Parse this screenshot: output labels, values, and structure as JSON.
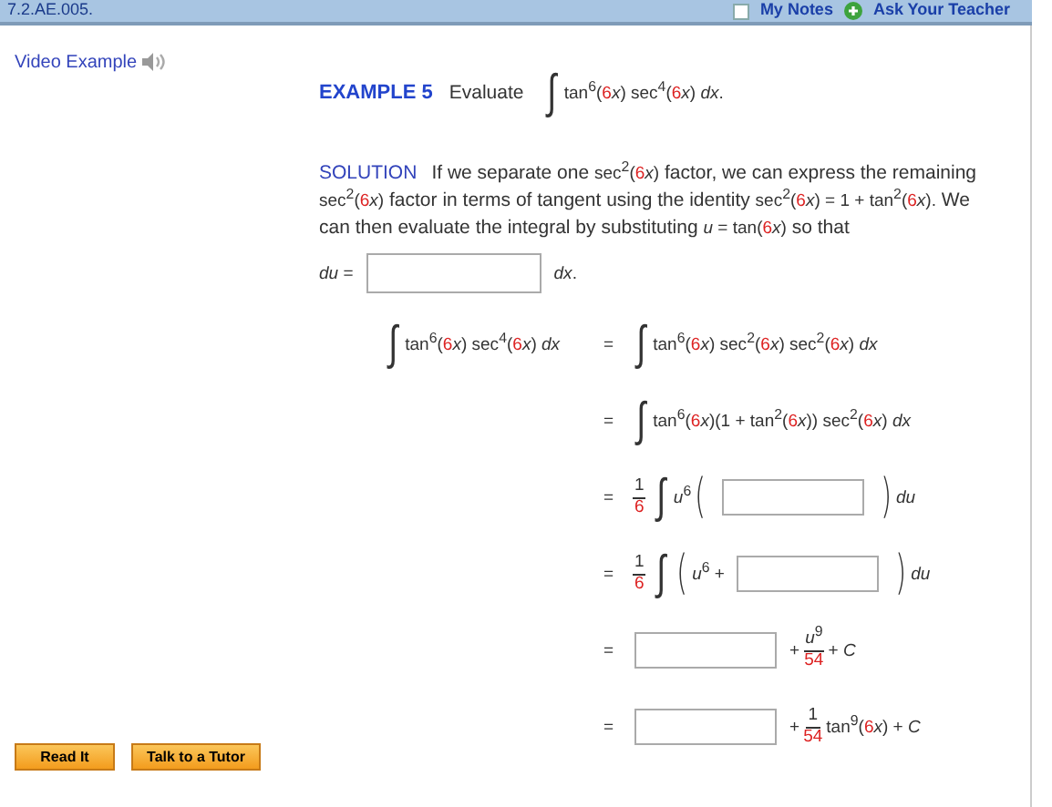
{
  "header": {
    "assignment": "7.2.AE.005.",
    "notes": {
      "label": "My Notes",
      "checked": false
    },
    "ask": "Ask Your Teacher"
  },
  "video_example": "Video Example",
  "example": {
    "label": "EXAMPLE 5",
    "prompt": "Evaluate",
    "expression": [
      {
        "kind": "integral",
        "t": "∫"
      },
      {
        "kind": "math",
        "t": "tan$^{6}$("
      },
      {
        "kind": "accent",
        "t": "6"
      },
      {
        "kind": "math",
        "t": "*x*) sec$^{4}$("
      },
      {
        "kind": "accent",
        "t": "6"
      },
      {
        "kind": "math",
        "t": "*x*) *dx*."
      }
    ]
  },
  "solution": {
    "label": "SOLUTION",
    "paragraph": [
      {
        "kind": "text",
        "t": "If we separate one "
      },
      {
        "kind": "math",
        "t": "sec$^{2}$("
      },
      {
        "kind": "accent",
        "t": "6"
      },
      {
        "kind": "math",
        "t": "*x*)"
      },
      {
        "kind": "text",
        "t": " factor, we can express the remaining "
      },
      {
        "kind": "math",
        "t": "sec$^{2}$("
      },
      {
        "kind": "accent",
        "t": "6"
      },
      {
        "kind": "math",
        "t": "*x*)"
      },
      {
        "kind": "text",
        "t": " factor in terms of tangent using the identity "
      },
      {
        "kind": "math",
        "t": "sec$^{2}$("
      },
      {
        "kind": "accent",
        "t": "6"
      },
      {
        "kind": "math",
        "t": "*x*) = 1 + tan$^{2}$("
      },
      {
        "kind": "accent",
        "t": "6"
      },
      {
        "kind": "math",
        "t": "*x*)."
      },
      {
        "kind": "text",
        "t": " We can then evaluate the integral by substituting "
      },
      {
        "kind": "math",
        "t": "*u* = tan("
      },
      {
        "kind": "accent",
        "t": "6"
      },
      {
        "kind": "math",
        "t": "*x*)"
      },
      {
        "kind": "text",
        "t": " so that"
      }
    ]
  },
  "du_row": [
    {
      "kind": "math",
      "t": "*du* ="
    },
    {
      "kind": "blank"
    },
    {
      "kind": "math",
      "t": "*dx*."
    }
  ],
  "steps": [
    {
      "lhs": [
        {
          "kind": "integral",
          "t": "∫"
        },
        {
          "kind": "math",
          "t": "tan$^{6}$("
        },
        {
          "kind": "accent",
          "t": "6"
        },
        {
          "kind": "math",
          "t": "*x*) sec$^{4}$("
        },
        {
          "kind": "accent",
          "t": "6"
        },
        {
          "kind": "math",
          "t": "*x*) *dx*"
        }
      ],
      "relation": "=",
      "rhs": [
        {
          "kind": "integral",
          "t": "∫"
        },
        {
          "kind": "math",
          "t": "tan$^{6}$("
        },
        {
          "kind": "accent",
          "t": "6"
        },
        {
          "kind": "math",
          "t": "*x*) sec$^{2}$("
        },
        {
          "kind": "accent",
          "t": "6"
        },
        {
          "kind": "math",
          "t": "*x*) sec$^{2}$("
        },
        {
          "kind": "accent",
          "t": "6"
        },
        {
          "kind": "math",
          "t": "*x*) *dx*"
        }
      ]
    },
    {
      "relation": "=",
      "rhs": [
        {
          "kind": "integral",
          "t": "∫"
        },
        {
          "kind": "math",
          "t": "tan$^{6}$("
        },
        {
          "kind": "accent",
          "t": "6"
        },
        {
          "kind": "math",
          "t": "*x*)(1 + tan$^{2}$("
        },
        {
          "kind": "accent",
          "t": "6"
        },
        {
          "kind": "math",
          "t": "*x*)) sec$^{2}$("
        },
        {
          "kind": "accent",
          "t": "6"
        },
        {
          "kind": "math",
          "t": "*x*) *dx*"
        }
      ]
    },
    {
      "relation": "=",
      "rhs": [
        {
          "kind": "frac",
          "num": [
            {
              "kind": "math",
              "t": "1"
            }
          ],
          "den": [
            {
              "kind": "accent",
              "t": "6"
            }
          ]
        },
        {
          "kind": "integral",
          "t": "∫"
        },
        {
          "kind": "math",
          "t": "*u*$^{6}$"
        },
        {
          "kind": "paren",
          "t": "("
        },
        {
          "kind": "blank"
        },
        {
          "kind": "paren",
          "t": ")"
        },
        {
          "kind": "math",
          "t": "*du*"
        }
      ]
    },
    {
      "relation": "=",
      "rhs": [
        {
          "kind": "frac",
          "num": [
            {
              "kind": "math",
              "t": "1"
            }
          ],
          "den": [
            {
              "kind": "accent",
              "t": "6"
            }
          ]
        },
        {
          "kind": "integral",
          "t": "∫"
        },
        {
          "kind": "paren",
          "t": "("
        },
        {
          "kind": "math",
          "t": "*u*$^{6}$ +"
        },
        {
          "kind": "blank"
        },
        {
          "kind": "paren",
          "t": ")"
        },
        {
          "kind": "math",
          "t": "*du*"
        }
      ]
    },
    {
      "relation": "=",
      "rhs": [
        {
          "kind": "blank"
        },
        {
          "kind": "math",
          "t": "+"
        },
        {
          "kind": "frac",
          "num": [
            {
              "kind": "math",
              "t": "*u*$^{9}$"
            }
          ],
          "den": [
            {
              "kind": "accent",
              "t": "54"
            }
          ]
        },
        {
          "kind": "math",
          "t": "+ *C*"
        }
      ]
    },
    {
      "relation": "=",
      "rhs": [
        {
          "kind": "blank"
        },
        {
          "kind": "math",
          "t": "+"
        },
        {
          "kind": "frac",
          "num": [
            {
              "kind": "math",
              "t": "1"
            }
          ],
          "den": [
            {
              "kind": "accent",
              "t": "54"
            }
          ]
        },
        {
          "kind": "math",
          "t": "tan$^{9}$("
        },
        {
          "kind": "accent",
          "t": "6"
        },
        {
          "kind": "math",
          "t": "*x*) + *C*"
        }
      ]
    }
  ],
  "buttons": [
    "Read It",
    "Talk to a Tutor"
  ]
}
